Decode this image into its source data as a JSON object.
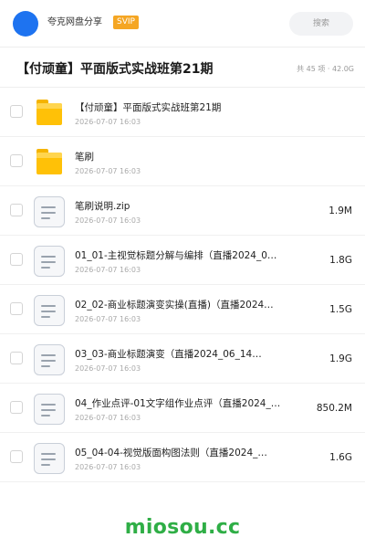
{
  "header": {
    "username": "夸克网盘分享",
    "badge": "SVIP",
    "search_placeholder": "搜索",
    "avatar_color": "#1e73f0"
  },
  "share": {
    "title": "【付顽童】平面版式实战班第21期",
    "meta": "共 45 项 · 42.0G"
  },
  "files": [
    {
      "type": "folder",
      "icon": "folder-icon",
      "name": "【付顽童】平面版式实战班第21期",
      "date": "2026-07-07 16:03",
      "size": ""
    },
    {
      "type": "folder",
      "icon": "folder-icon",
      "name": "笔刷",
      "date": "2026-07-07 16:03",
      "size": ""
    },
    {
      "type": "file",
      "icon": "document-icon",
      "name": "笔刷说明.zip",
      "date": "2026-07-07 16:03",
      "size": "1.9M"
    },
    {
      "type": "file",
      "icon": "document-icon",
      "name": "01_01-主视觉标题分解与编排（直播2024_0…",
      "date": "2026-07-07 16:03",
      "size": "1.8G"
    },
    {
      "type": "file",
      "icon": "document-icon",
      "name": "02_02-商业标题演变实操(直播)（直播2024…",
      "date": "2026-07-07 16:03",
      "size": "1.5G"
    },
    {
      "type": "file",
      "icon": "document-icon",
      "name": "03_03-商业标题演变（直播2024_06_14…",
      "date": "2026-07-07 16:03",
      "size": "1.9G"
    },
    {
      "type": "file",
      "icon": "document-icon",
      "name": "04_作业点评-01文字组作业点评（直播2024_…",
      "date": "2026-07-07 16:03",
      "size": "850.2M"
    },
    {
      "type": "file",
      "icon": "document-icon",
      "name": "05_04-04-视觉版面构图法则（直播2024_…",
      "date": "2026-07-07 16:03",
      "size": "1.6G"
    }
  ],
  "watermark": "miosou.cc",
  "colors": {
    "badge": "#f5a623",
    "folder": "#ffc107",
    "watermark": "#2fae46"
  }
}
